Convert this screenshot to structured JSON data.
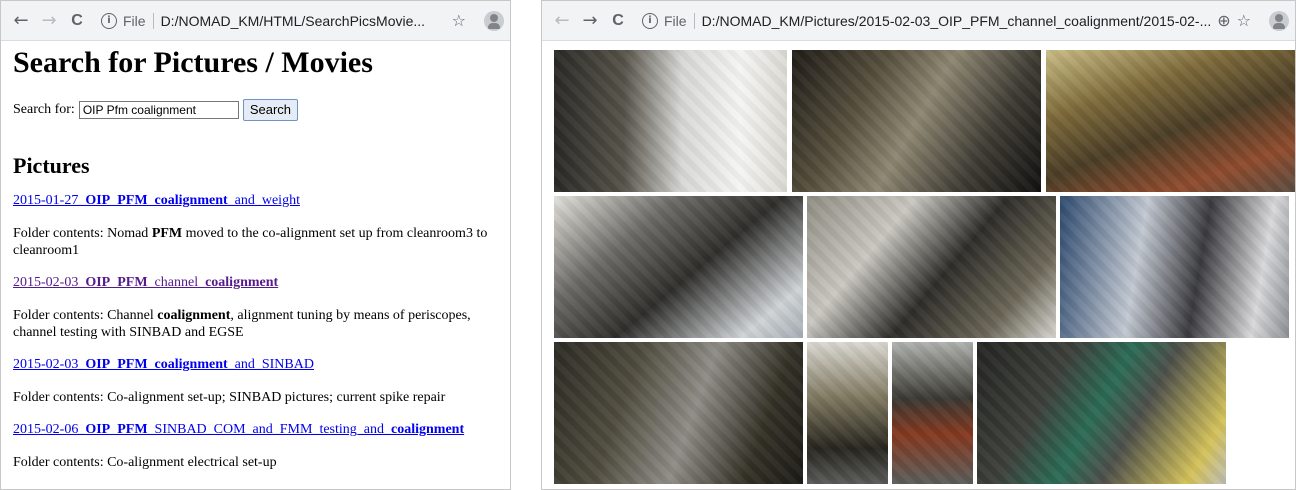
{
  "left_window": {
    "url": "D:/NOMAD_KM/HTML/SearchPicsMovie...",
    "file_label": "File",
    "page_title": "Search for Pictures / Movies",
    "search": {
      "label": "Search for:",
      "value": "OIP Pfm coalignment",
      "button_label": "Search"
    },
    "section_title": "Pictures",
    "results": [
      {
        "link_parts": [
          {
            "text": "2015-01-27_",
            "bold": false
          },
          {
            "text": "OIP_PFM_coalignment",
            "bold": true
          },
          {
            "text": "_and_weight",
            "bold": false
          }
        ],
        "visited": false,
        "desc_parts": [
          {
            "text": "Folder contents: Nomad ",
            "bold": false
          },
          {
            "text": "PFM",
            "bold": true
          },
          {
            "text": " moved to the co-alignment set up from cleanroom3 to cleanroom1",
            "bold": false
          }
        ]
      },
      {
        "link_parts": [
          {
            "text": "2015-02-03_",
            "bold": false
          },
          {
            "text": "OIP_PFM",
            "bold": true
          },
          {
            "text": "_channel_",
            "bold": false
          },
          {
            "text": "coalignment",
            "bold": true
          }
        ],
        "visited": true,
        "desc_parts": [
          {
            "text": "Folder contents: Channel ",
            "bold": false
          },
          {
            "text": "coalignment",
            "bold": true
          },
          {
            "text": ", alignment tuning by means of periscopes, channel testing with SINBAD and EGSE",
            "bold": false
          }
        ]
      },
      {
        "link_parts": [
          {
            "text": "2015-02-03_",
            "bold": false
          },
          {
            "text": "OIP_PFM_coalignment",
            "bold": true
          },
          {
            "text": "_and_SINBAD",
            "bold": false
          }
        ],
        "visited": false,
        "desc_parts": [
          {
            "text": "Folder contents: Co-alignment set-up; SINBAD pictures; current spike repair",
            "bold": false
          }
        ]
      },
      {
        "link_parts": [
          {
            "text": "2015-02-06_",
            "bold": false
          },
          {
            "text": "OIP_PFM",
            "bold": true
          },
          {
            "text": "_SINBAD_COM_and_FMM_testing_and_",
            "bold": false
          },
          {
            "text": "coalignment",
            "bold": true
          }
        ],
        "visited": false,
        "desc_parts": [
          {
            "text": "Folder contents: Co-alignment electrical set-up",
            "bold": false
          }
        ]
      }
    ]
  },
  "right_window": {
    "url": "D:/NOMAD_KM/Pictures/2015-02-03_OIP_PFM_channel_coalignment/2015-02-...",
    "file_label": "File",
    "photos": [
      {
        "name": "photo-camera-setup"
      },
      {
        "name": "photo-optical-bench"
      },
      {
        "name": "photo-circuit-board"
      },
      {
        "name": "photo-nomad-instrument"
      },
      {
        "name": "photo-cleanroom-lab"
      },
      {
        "name": "photo-cleanroom-workers"
      },
      {
        "name": "photo-periscope-setup"
      },
      {
        "name": "photo-mount-closeup"
      },
      {
        "name": "photo-rig-closeup"
      },
      {
        "name": "photo-green-light-port"
      }
    ]
  },
  "icons": {
    "back": "←",
    "forward": "→",
    "reload": "C",
    "info": "i",
    "zoom": "⊕",
    "star": "☆"
  },
  "colors": {
    "link": "#0000ee",
    "visited_link": "#551a8b",
    "toolbar_bg": "#f1f3f4"
  }
}
